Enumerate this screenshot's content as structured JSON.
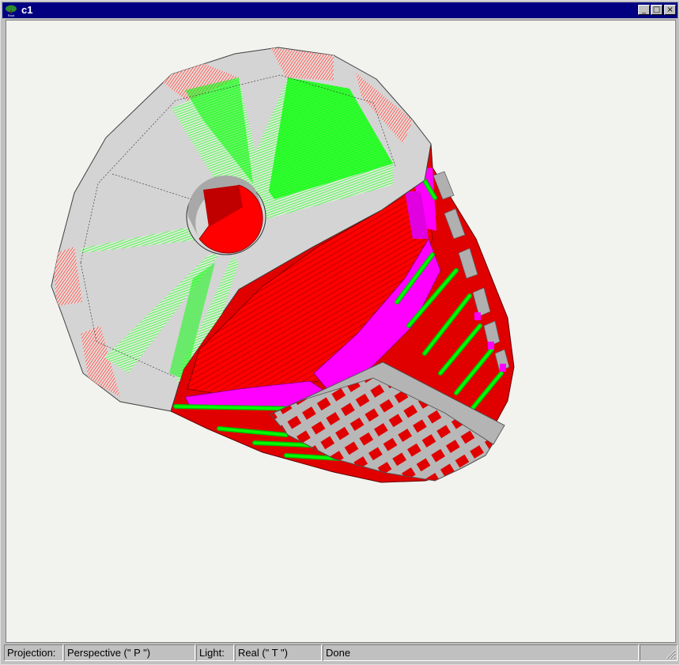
{
  "window": {
    "title": "c1",
    "minimize_symbol": "_",
    "maximize_symbol": "□",
    "close_symbol": "×"
  },
  "status": {
    "projection_label": "Projection:",
    "projection_value": "Perspective (\" P \")",
    "light_label": "Light:",
    "light_value": "Real (\" T \")",
    "message": "Done"
  },
  "colors": {
    "titlebar": "#000080",
    "panel": "#c0c0c0",
    "canvas": "#f2f2ee",
    "gray_surface": "#d0d0d0",
    "red": "#ff0000",
    "dark_red": "#c80000",
    "green": "#00ff00",
    "magenta": "#ff00ff"
  },
  "icons": {
    "app": "root-tree-icon",
    "resize": "resize-grip-icon"
  }
}
